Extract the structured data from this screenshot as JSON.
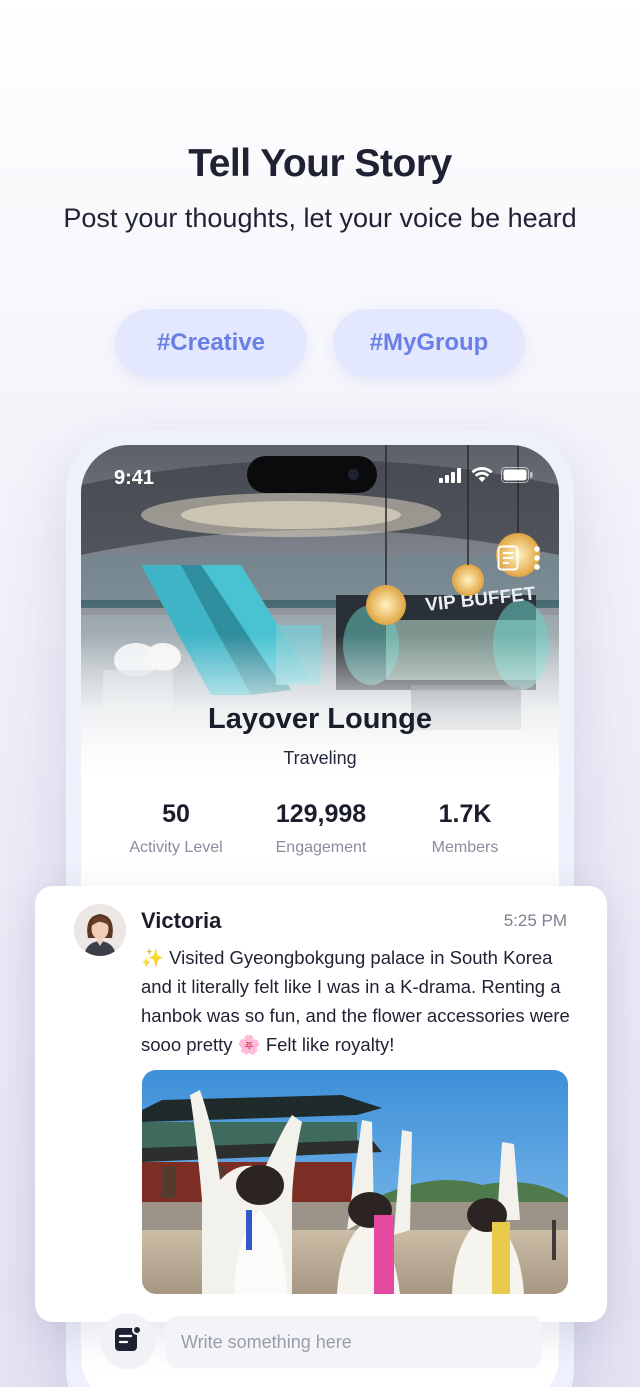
{
  "header": {
    "title": "Tell Your Story",
    "subtitle": "Post your thoughts, let your voice be heard"
  },
  "tags": [
    {
      "label": "#Creative"
    },
    {
      "label": "#MyGroup"
    }
  ],
  "phone": {
    "status_time": "9:41",
    "hero_sign": "VIP BUFFET",
    "group": {
      "name": "Layover Lounge",
      "category": "Traveling"
    },
    "stats": [
      {
        "value": "50",
        "label": "Activity Level"
      },
      {
        "value": "129,998",
        "label": "Engagement"
      },
      {
        "value": "1.7K",
        "label": "Members"
      }
    ]
  },
  "post": {
    "author": "Victoria",
    "time": "5:25 PM",
    "text": "✨ Visited Gyeongbokgung palace in South Korea and it literally felt like I was in a K-drama. Renting a hanbok was so fun, and the flower accessories were sooo pretty 🌸 Felt like royalty!"
  },
  "composer": {
    "placeholder": "Write something here"
  },
  "icons": {
    "tag_icons": [
      "note-icon",
      "more-vertical-icon",
      "signal-icon",
      "wifi-icon",
      "battery-icon",
      "compose-icon"
    ]
  },
  "colors": {
    "tag_bg": "#e3e8ff",
    "tag_text": "#6a7fe6",
    "text_dark": "#1f2233",
    "text_muted": "#8a8d9c"
  }
}
